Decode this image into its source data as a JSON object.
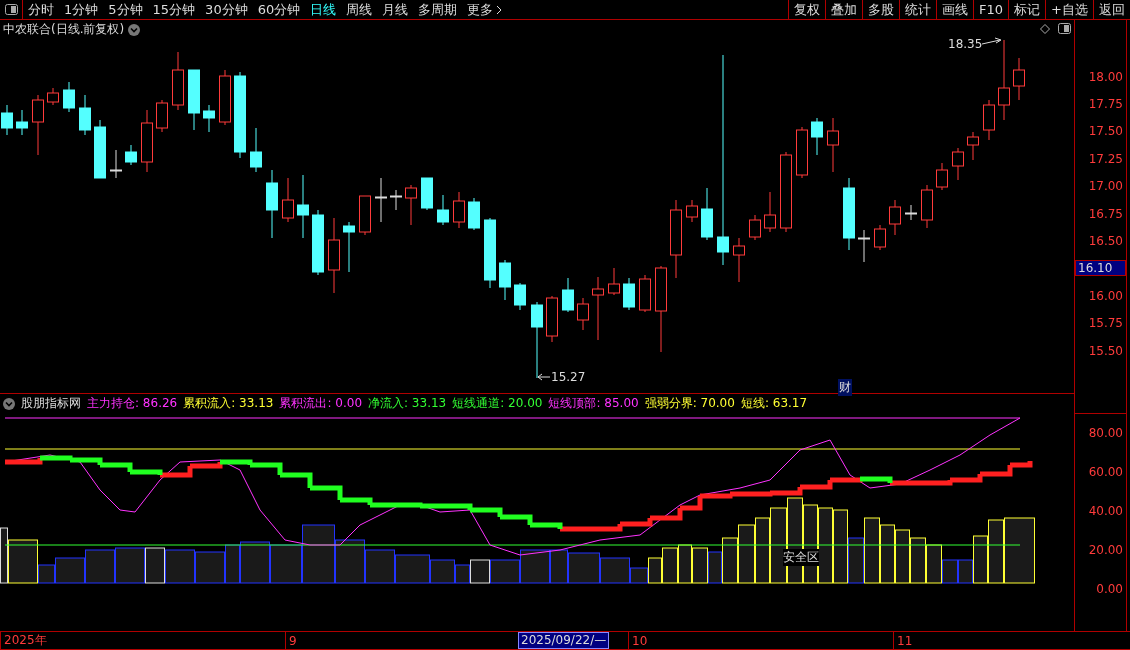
{
  "toolbar": {
    "periods": [
      {
        "label": "分时",
        "selected": false
      },
      {
        "label": "1分钟",
        "selected": false
      },
      {
        "label": "5分钟",
        "selected": false
      },
      {
        "label": "15分钟",
        "selected": false
      },
      {
        "label": "30分钟",
        "selected": false
      },
      {
        "label": "60分钟",
        "selected": false
      },
      {
        "label": "日线",
        "selected": true
      },
      {
        "label": "周线",
        "selected": false
      },
      {
        "label": "月线",
        "selected": false
      },
      {
        "label": "多周期",
        "selected": false
      }
    ],
    "more": "更多",
    "actions": [
      "复权",
      "叠加",
      "多股",
      "统计",
      "画线",
      "F10",
      "标记",
      "+自选",
      "返回"
    ]
  },
  "price_chart": {
    "title": "中农联合(日线.前复权)",
    "high_marker": "18.35",
    "low_marker": "15.27",
    "news_marker": "财",
    "axis": [
      {
        "kind": "tick",
        "label": "18.00"
      },
      {
        "kind": "tick",
        "label": "17.75"
      },
      {
        "kind": "tick",
        "label": "17.50"
      },
      {
        "kind": "tick",
        "label": "17.25"
      },
      {
        "kind": "tick",
        "label": "17.00"
      },
      {
        "kind": "tick",
        "label": "16.75"
      },
      {
        "kind": "tick",
        "label": "16.50"
      },
      {
        "kind": "current",
        "label": "16.10"
      },
      {
        "kind": "tick",
        "label": "16.00"
      },
      {
        "kind": "tick",
        "label": "15.75"
      },
      {
        "kind": "tick",
        "label": "15.50"
      }
    ]
  },
  "indicator": {
    "name": "股朋指标网",
    "zone_label": "安全区",
    "values": [
      {
        "label": "主力持仓: 86.26",
        "color": "#ff33ff"
      },
      {
        "label": "累积流入: 33.13",
        "color": "#ffff33"
      },
      {
        "label": "累积流出: 0.00",
        "color": "#ff33ff"
      },
      {
        "label": "净流入: 33.13",
        "color": "#33ff33"
      },
      {
        "label": "短线通道: 20.00",
        "color": "#33ff33"
      },
      {
        "label": "短线顶部: 85.00",
        "color": "#ff33ff"
      },
      {
        "label": "强弱分界: 70.00",
        "color": "#ffff33"
      },
      {
        "label": "短线: 63.17",
        "color": "#ffff33"
      }
    ],
    "axis": [
      "80.00",
      "60.00",
      "40.00",
      "20.00",
      "0.00"
    ]
  },
  "time_axis": {
    "months": [
      "2025年",
      "9",
      "10",
      "11"
    ],
    "cursor_date": "2025/09/22/—"
  }
}
